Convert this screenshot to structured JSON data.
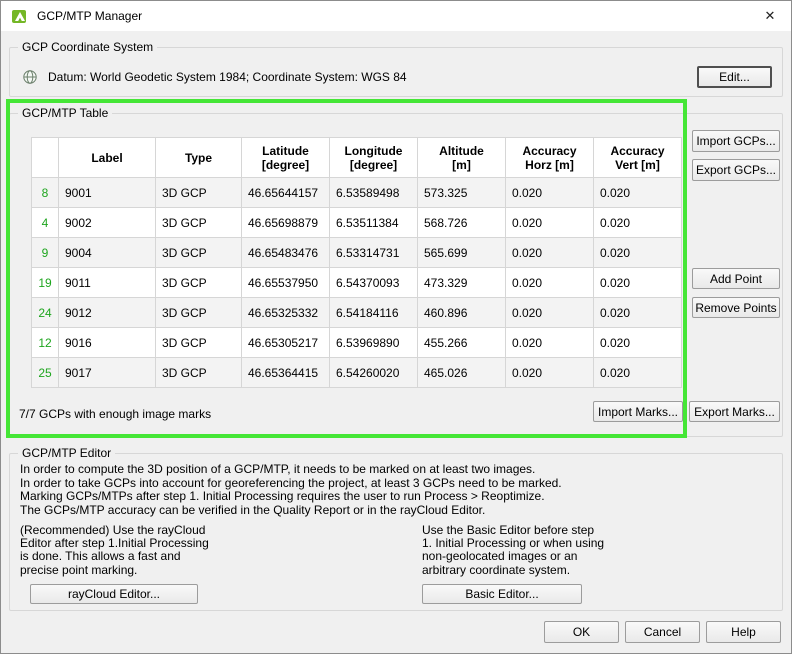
{
  "window": {
    "title": "GCP/MTP Manager",
    "close_glyph": "✕"
  },
  "coordinate_system": {
    "group_label": "GCP Coordinate System",
    "datum_text": "Datum: World Geodetic System 1984; Coordinate System: WGS 84",
    "edit_button": "Edit..."
  },
  "gcp_table": {
    "group_label": "GCP/MTP Table",
    "highlight_color": "#45e636",
    "columns": [
      "Label",
      "Type",
      "Latitude\n[degree]",
      "Longitude\n[degree]",
      "Altitude\n[m]",
      "Accuracy\nHorz [m]",
      "Accuracy\nVert [m]"
    ],
    "rows": [
      {
        "num": "8",
        "label": "9001",
        "type": "3D GCP",
        "latitude": "46.65644157",
        "longitude": "6.53589498",
        "altitude": "573.325",
        "acc_horz": "0.020",
        "acc_vert": "0.020"
      },
      {
        "num": "4",
        "label": "9002",
        "type": "3D GCP",
        "latitude": "46.65698879",
        "longitude": "6.53511384",
        "altitude": "568.726",
        "acc_horz": "0.020",
        "acc_vert": "0.020"
      },
      {
        "num": "9",
        "label": "9004",
        "type": "3D GCP",
        "latitude": "46.65483476",
        "longitude": "6.53314731",
        "altitude": "565.699",
        "acc_horz": "0.020",
        "acc_vert": "0.020"
      },
      {
        "num": "19",
        "label": "9011",
        "type": "3D GCP",
        "latitude": "46.65537950",
        "longitude": "6.54370093",
        "altitude": "473.329",
        "acc_horz": "0.020",
        "acc_vert": "0.020"
      },
      {
        "num": "24",
        "label": "9012",
        "type": "3D GCP",
        "latitude": "46.65325332",
        "longitude": "6.54184116",
        "altitude": "460.896",
        "acc_horz": "0.020",
        "acc_vert": "0.020"
      },
      {
        "num": "12",
        "label": "9016",
        "type": "3D GCP",
        "latitude": "46.65305217",
        "longitude": "6.53969890",
        "altitude": "455.266",
        "acc_horz": "0.020",
        "acc_vert": "0.020"
      },
      {
        "num": "25",
        "label": "9017",
        "type": "3D GCP",
        "latitude": "46.65364415",
        "longitude": "6.54260020",
        "altitude": "465.026",
        "acc_horz": "0.020",
        "acc_vert": "0.020"
      }
    ],
    "import_gcps_button": "Import GCPs...",
    "export_gcps_button": "Export GCPs...",
    "add_point_button": "Add Point",
    "remove_points_button": "Remove Points",
    "status_text": "7/7 GCPs with enough image marks",
    "import_marks_button": "Import Marks...",
    "export_marks_button": "Export Marks..."
  },
  "editor": {
    "group_label": "GCP/MTP Editor",
    "lines": [
      "In order to compute the 3D position of a GCP/MTP, it needs to be marked on at least two images.",
      "In order to take GCPs into account for georeferencing the project, at least 3 GCPs need to be marked.",
      "Marking GCPs/MTPs after step 1. Initial Processing requires the user to run Process > Reoptimize.",
      "The GCPs/MTP accuracy can be verified in the Quality Report or in the rayCloud Editor."
    ],
    "raycloud_note": "(Recommended) Use the rayCloud Editor after step 1.Initial Processing is done. This allows a fast and precise point marking.",
    "basic_note": "Use the Basic Editor before step 1. Initial Processing or when using non-geolocated images or an arbitrary coordinate system.",
    "raycloud_button": "rayCloud Editor...",
    "basic_button": "Basic Editor..."
  },
  "footer": {
    "ok": "OK",
    "cancel": "Cancel",
    "help": "Help"
  }
}
